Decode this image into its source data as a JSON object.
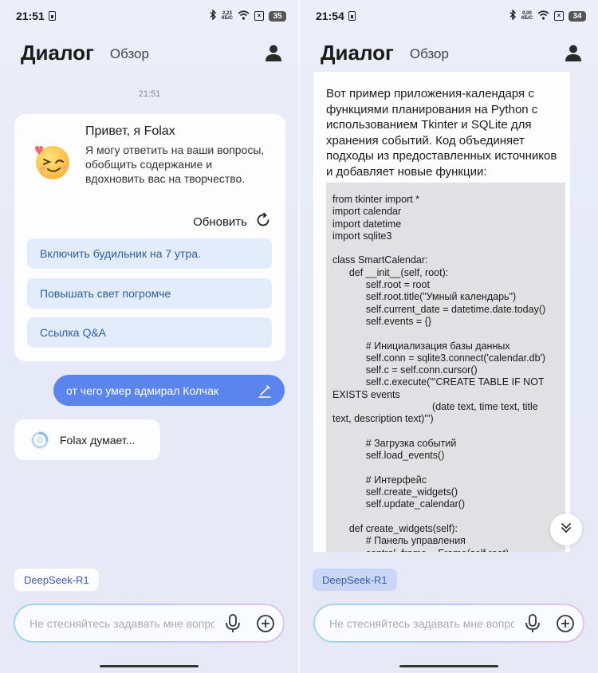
{
  "left": {
    "status": {
      "time": "21:51",
      "net_speed_top": "2,23",
      "net_speed_bottom": "КБ/С",
      "battery": "35"
    },
    "header": {
      "title": "Диалог",
      "tab_overview": "Обзор"
    },
    "time_separator": "21:51",
    "welcome": {
      "title": "Привет, я Folax",
      "text": "Я могу ответить на ваши вопросы, обобщить содержание и вдохновить вас на творчество.",
      "refresh_label": "Обновить",
      "suggestions": [
        "Включить будильник на 7 утра.",
        "Повышать свет погромче",
        "Ссылка Q&A"
      ]
    },
    "user_message": "от чего умер адмирал Колчак",
    "thinking": "Folax думает...",
    "model_chip": "DeepSeek-R1",
    "input_placeholder": "Не стесняйтесь задавать мне вопросы"
  },
  "right": {
    "status": {
      "time": "21:54",
      "net_speed_top": "0,00",
      "net_speed_bottom": "КБ/С",
      "battery": "34"
    },
    "header": {
      "title": "Диалог",
      "tab_overview": "Обзор"
    },
    "answer_intro": "Вот пример приложения-календаря с функциями планирования на Python с использованием Tkinter и SQLite для хранения событий. Код объединяет подходы из предоставленных источников и добавляет новые функции:",
    "code": "from tkinter import *\nimport calendar\nimport datetime\nimport sqlite3\n\nclass SmartCalendar:\n      def __init__(self, root):\n            self.root = root\n            self.root.title(\"Умный календарь\")\n            self.current_date = datetime.date.today()\n            self.events = {}\n\n            # Инициализация базы данных\n            self.conn = sqlite3.connect('calendar.db')\n            self.c = self.conn.cursor()\n            self.c.execute('''CREATE TABLE IF NOT EXISTS events\n                                    (date text, time text, title text, description text)''')\n\n            # Загрузка событий\n            self.load_events()\n\n            # Интерфейс\n            self.create_widgets()\n            self.update_calendar()\n\n      def create_widgets(self):\n            # Панель управления\n            control_frame = Frame(self.root)",
    "model_chip": "DeepSeek-R1",
    "input_placeholder": "Не стесняйтесь задавать мне вопросы"
  },
  "colors": {
    "accent": "#5b85ec",
    "suggestion_bg": "#e3ecfa",
    "suggestion_text": "#2b5f9c"
  }
}
